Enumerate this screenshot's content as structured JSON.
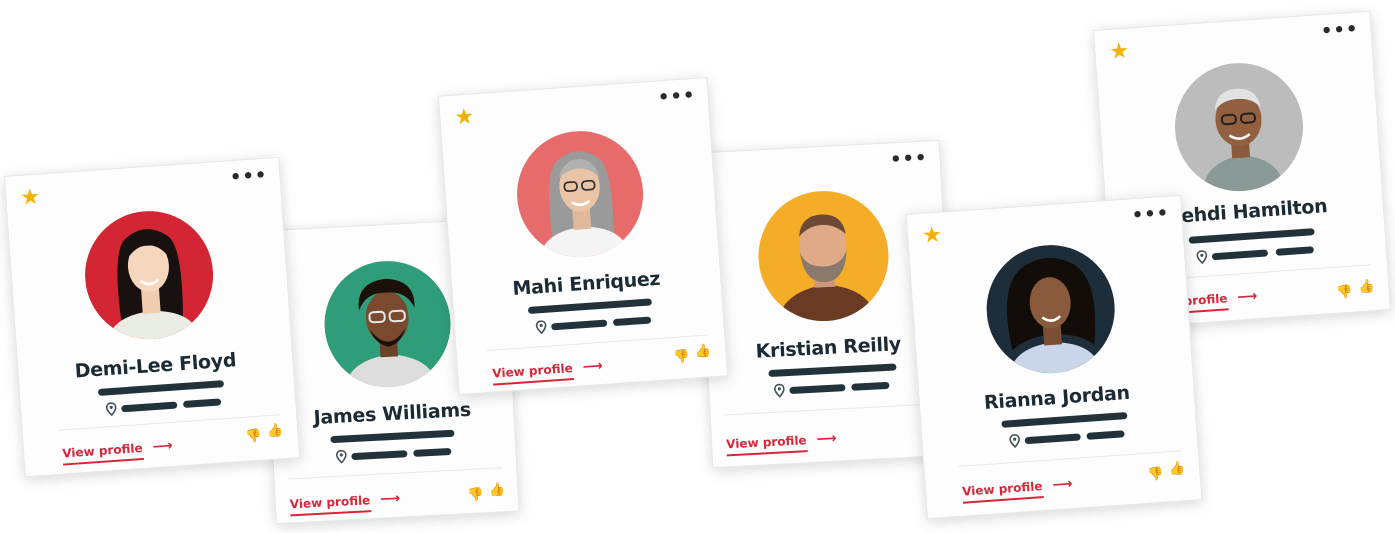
{
  "cards": [
    {
      "name": "Demi-Lee Floyd",
      "link": "View profile",
      "starred": true,
      "avatar_color": "#d32534"
    },
    {
      "name": "James Williams",
      "link": "View profile",
      "starred": false,
      "avatar_color": "#2f9c7a"
    },
    {
      "name": "Mahi Enriquez",
      "link": "View profile",
      "starred": true,
      "avatar_color": "#e86b6b"
    },
    {
      "name": "Kristian Reilly",
      "link": "View profile",
      "starred": false,
      "avatar_color": "#f5ad28"
    },
    {
      "name": "Rianna Jordan",
      "link": "View profile",
      "starred": true,
      "avatar_color": "#1e2d3a"
    },
    {
      "name": "Mehdi Hamilton",
      "link": "View profile",
      "starred": true,
      "avatar_color": "#bcbcbc"
    }
  ],
  "icons": {
    "star": "★",
    "menu": "•••",
    "arrow": "⟶",
    "thumbs_down": "👎",
    "thumbs_up": "👍"
  },
  "colors": {
    "accent_red": "#d5263a",
    "accent_green": "#2f9f75",
    "star_gold": "#f3b200",
    "text_dark": "#1c2a33"
  }
}
